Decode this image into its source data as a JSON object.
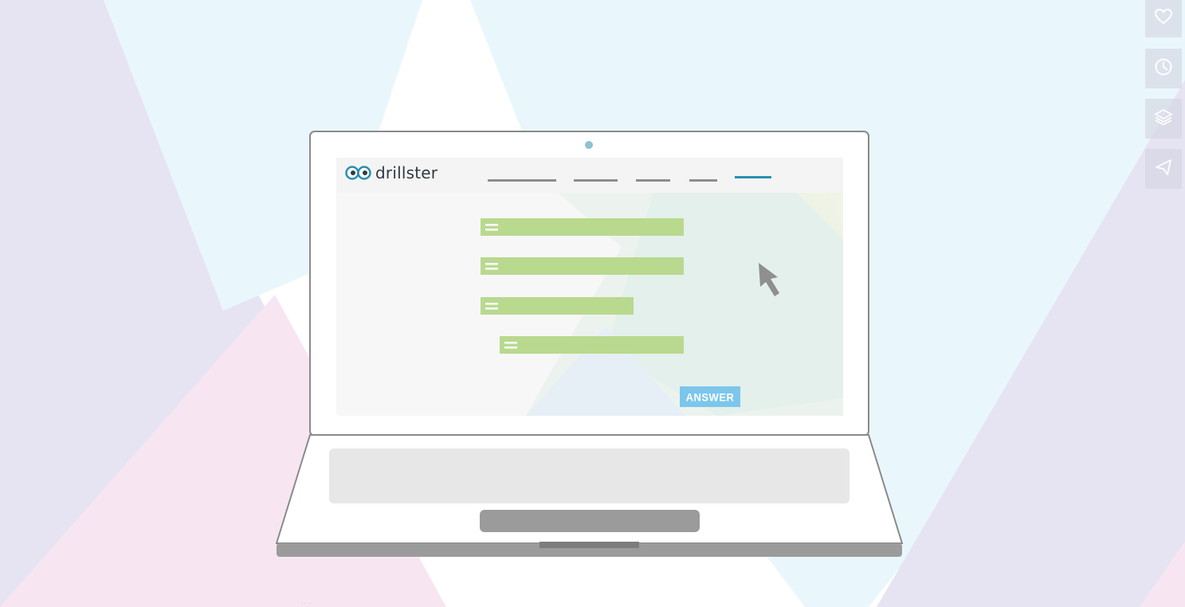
{
  "app": {
    "brand_name": "drillster",
    "answer_label": "ANSWER",
    "footer_hint": "·· ··"
  },
  "nav_tabs": [
    {
      "state": "inactive"
    },
    {
      "state": "inactive"
    },
    {
      "state": "inactive"
    },
    {
      "state": "inactive"
    },
    {
      "state": "active"
    }
  ],
  "answer_items": [
    {
      "kind": "drag-item",
      "icon": "drag-handle-icon"
    },
    {
      "kind": "drag-item",
      "icon": "drag-handle-icon"
    },
    {
      "kind": "drag-item",
      "icon": "drag-handle-icon"
    },
    {
      "kind": "drag-item",
      "icon": "drag-handle-icon"
    }
  ],
  "side_actions": [
    {
      "icon": "heart-icon",
      "action": "favorite"
    },
    {
      "icon": "clock-icon",
      "action": "history"
    },
    {
      "icon": "layers-icon",
      "action": "collections"
    },
    {
      "icon": "send-icon",
      "action": "share"
    }
  ],
  "colors": {
    "accent": "#2a8fb0",
    "answer_button": "#7cc6ec",
    "item_green": "#b9d98f",
    "nav_line": "#8d8d8d",
    "bg_lavender": "#e6e4f3",
    "bg_sky": "#e9f7fc",
    "bg_pink": "#f7e6f1"
  }
}
